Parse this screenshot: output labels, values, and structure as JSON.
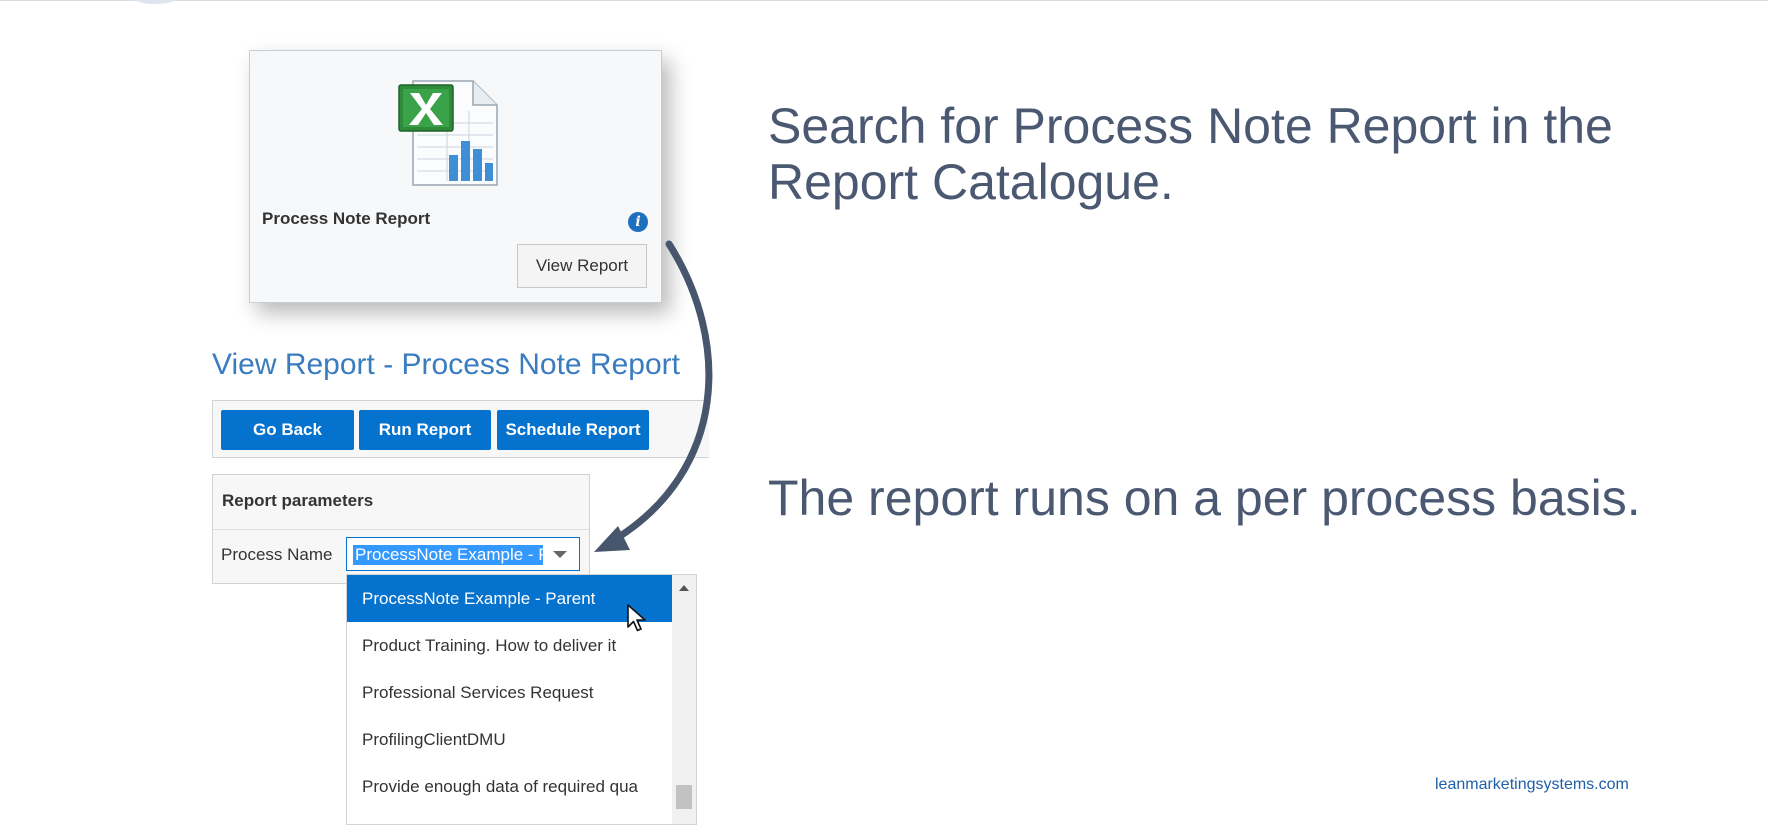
{
  "tile": {
    "title": "Process Note Report",
    "view_button": "View Report",
    "info_glyph": "i"
  },
  "page_heading": "View Report - Process Note Report",
  "toolbar": {
    "go_back": "Go Back",
    "run_report": "Run Report",
    "schedule_report": "Schedule Report"
  },
  "parameters": {
    "header": "Report parameters",
    "process_name_label": "Process Name",
    "process_name_value": "ProcessNote Example - P"
  },
  "dropdown": {
    "options": [
      "ProcessNote Example - Parent",
      "Product Training. How to deliver it",
      "Professional Services Request",
      "ProfilingClientDMU",
      "Provide enough data of required qua"
    ],
    "selected_index": 0
  },
  "captions": {
    "first": "Search for Process Note Report in the Report Catalogue.",
    "second": "The report runs on a per process basis."
  },
  "footer": {
    "url": "leanmarketingsystems.com"
  },
  "colors": {
    "primary_button": "#0572ce",
    "heading_blue": "#3a7cc0",
    "caption_text": "#4b5871",
    "arrow": "#47556d"
  }
}
